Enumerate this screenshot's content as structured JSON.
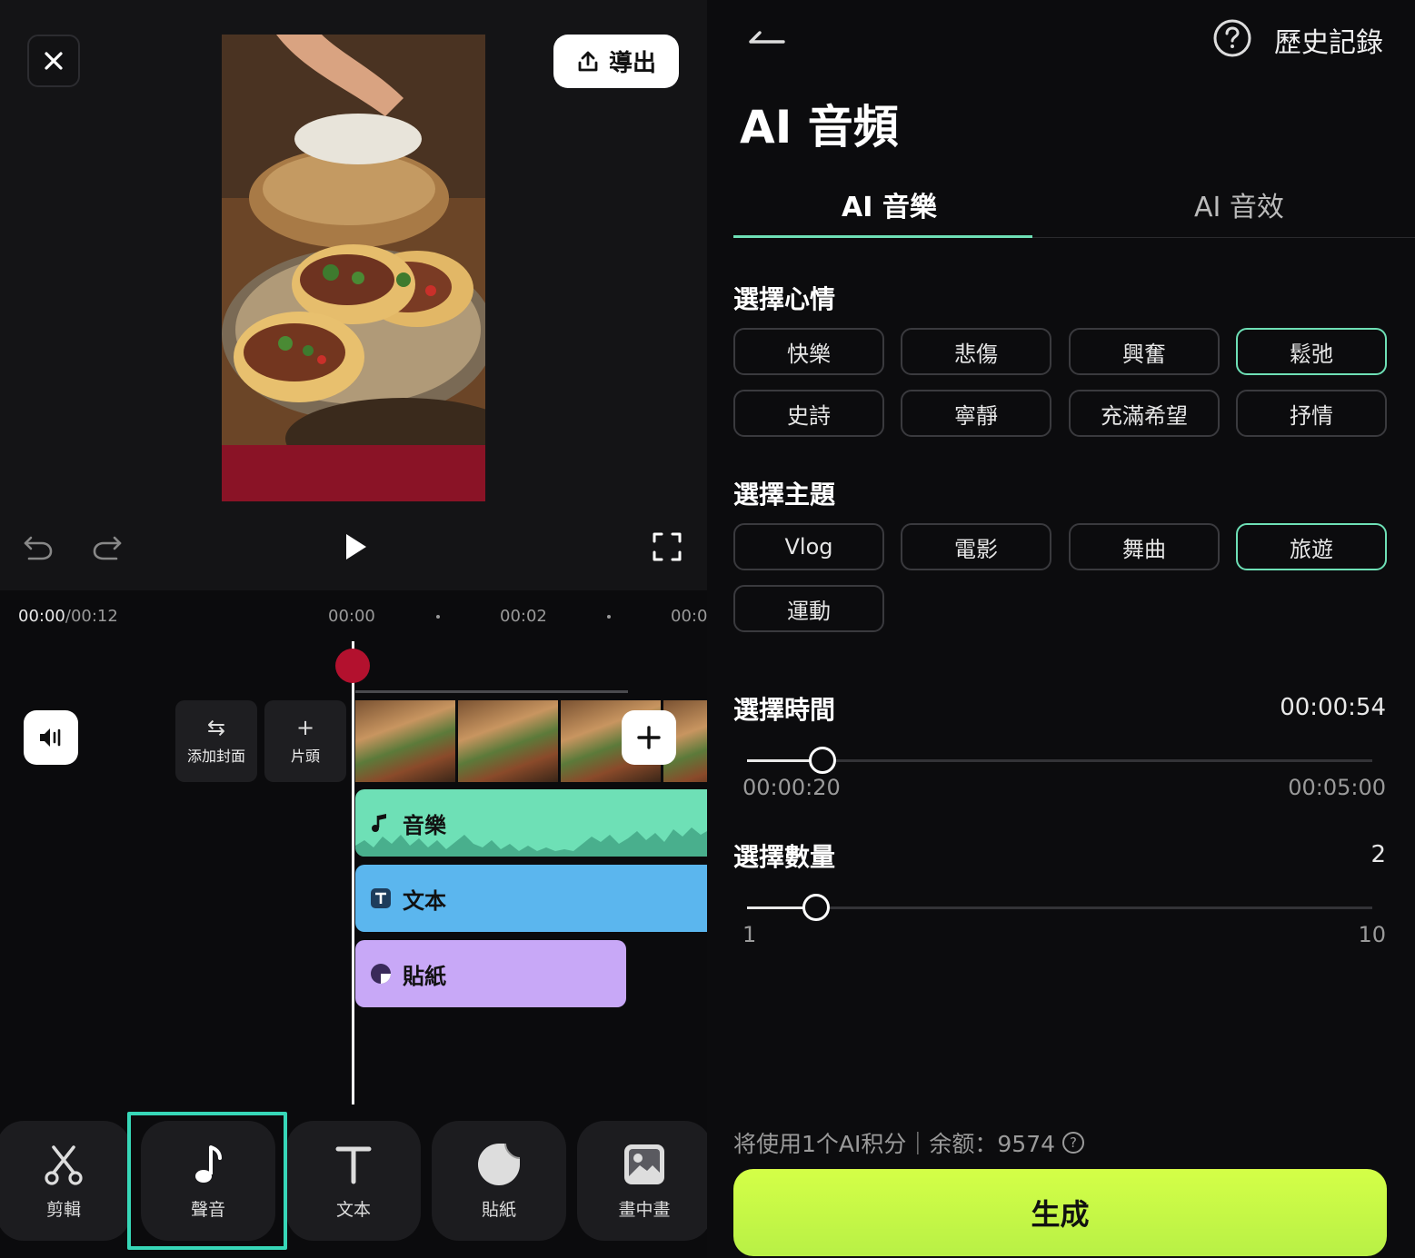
{
  "editor": {
    "export_label": "導出",
    "timecode_current": "00:00",
    "timecode_total": "/00:12",
    "ruler_labels": [
      "00:00",
      "00:02",
      "00:0"
    ],
    "cover_label": "添加封面",
    "intro_label": "片頭",
    "tracks": {
      "music": "音樂",
      "text": "文本",
      "sticker": "貼紙"
    },
    "toolbar": [
      {
        "label": "剪輯",
        "icon": "scissors-icon"
      },
      {
        "label": "聲音",
        "icon": "music-note-icon",
        "selected": true
      },
      {
        "label": "文本",
        "icon": "text-t-icon"
      },
      {
        "label": "貼紙",
        "icon": "sticker-icon"
      },
      {
        "label": "畫中畫",
        "icon": "picture-in-picture-icon"
      }
    ]
  },
  "ai_panel": {
    "history_label": "歷史記錄",
    "title": "AI 音頻",
    "tabs": [
      {
        "label": "AI 音樂",
        "active": true
      },
      {
        "label": "AI 音效",
        "active": false
      }
    ],
    "mood": {
      "label": "選擇心情",
      "options": [
        {
          "label": "快樂",
          "selected": false
        },
        {
          "label": "悲傷",
          "selected": false
        },
        {
          "label": "興奮",
          "selected": false
        },
        {
          "label": "鬆弛",
          "selected": true
        },
        {
          "label": "史詩",
          "selected": false
        },
        {
          "label": "寧靜",
          "selected": false
        },
        {
          "label": "充滿希望",
          "selected": false
        },
        {
          "label": "抒情",
          "selected": false
        }
      ]
    },
    "theme": {
      "label": "選擇主題",
      "options": [
        {
          "label": "Vlog",
          "selected": false
        },
        {
          "label": "電影",
          "selected": false
        },
        {
          "label": "舞曲",
          "selected": false
        },
        {
          "label": "旅遊",
          "selected": true
        },
        {
          "label": "運動",
          "selected": false
        }
      ]
    },
    "duration": {
      "label": "選擇時間",
      "value": "00:00:54",
      "min_label": "00:00:20",
      "max_label": "00:05:00",
      "fraction": 0.12
    },
    "count": {
      "label": "選擇數量",
      "value": "2",
      "min_label": "1",
      "max_label": "10",
      "fraction": 0.11
    },
    "credits_text": "将使用1个AI积分｜余额：9574",
    "generate_label": "生成"
  },
  "colors": {
    "accent_teal": "#6ee0b6",
    "generate_green": "#c8f84a",
    "music_track": "#6ee0b6",
    "text_track": "#5bb6ee",
    "sticker_track": "#c8a8f7",
    "playhead": "#b3112e"
  }
}
